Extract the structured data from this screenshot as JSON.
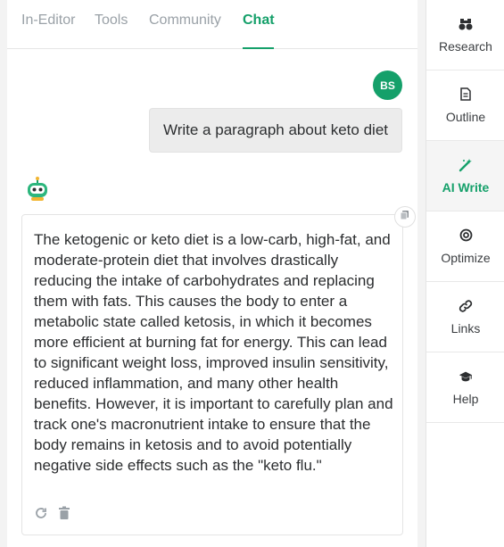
{
  "tabs": [
    {
      "label": "In-Editor"
    },
    {
      "label": "Tools"
    },
    {
      "label": "Community"
    },
    {
      "label": "Chat"
    }
  ],
  "active_tab": "Chat",
  "user": {
    "initials": "BS"
  },
  "chat": {
    "user_message": "Write a paragraph about keto diet",
    "bot_response": "The ketogenic or keto diet is a low-carb, high-fat, and moderate-protein diet that involves drastically reducing the intake of carbohydrates and replacing them with fats. This causes the body to enter a metabolic state called ketosis, in which it becomes more efficient at burning fat for energy. This can lead to significant weight loss, improved insulin sensitivity, reduced inflammation, and many other health benefits. However, it is important to carefully plan and track one's macronutrient intake to ensure that the body remains in ketosis and to avoid potentially negative side effects such as the \"keto flu.\""
  },
  "sidebar": {
    "items": [
      {
        "label": "Research",
        "icon": "binoculars-icon"
      },
      {
        "label": "Outline",
        "icon": "document-icon"
      },
      {
        "label": "AI Write",
        "icon": "magic-wand-icon"
      },
      {
        "label": "Optimize",
        "icon": "target-icon"
      },
      {
        "label": "Links",
        "icon": "link-icon"
      },
      {
        "label": "Help",
        "icon": "graduation-cap-icon"
      }
    ],
    "active": "AI Write"
  },
  "colors": {
    "accent": "#15a06a",
    "text": "#2b2d2f",
    "muted": "#9aa1a7",
    "background": "#f3f3f3"
  }
}
